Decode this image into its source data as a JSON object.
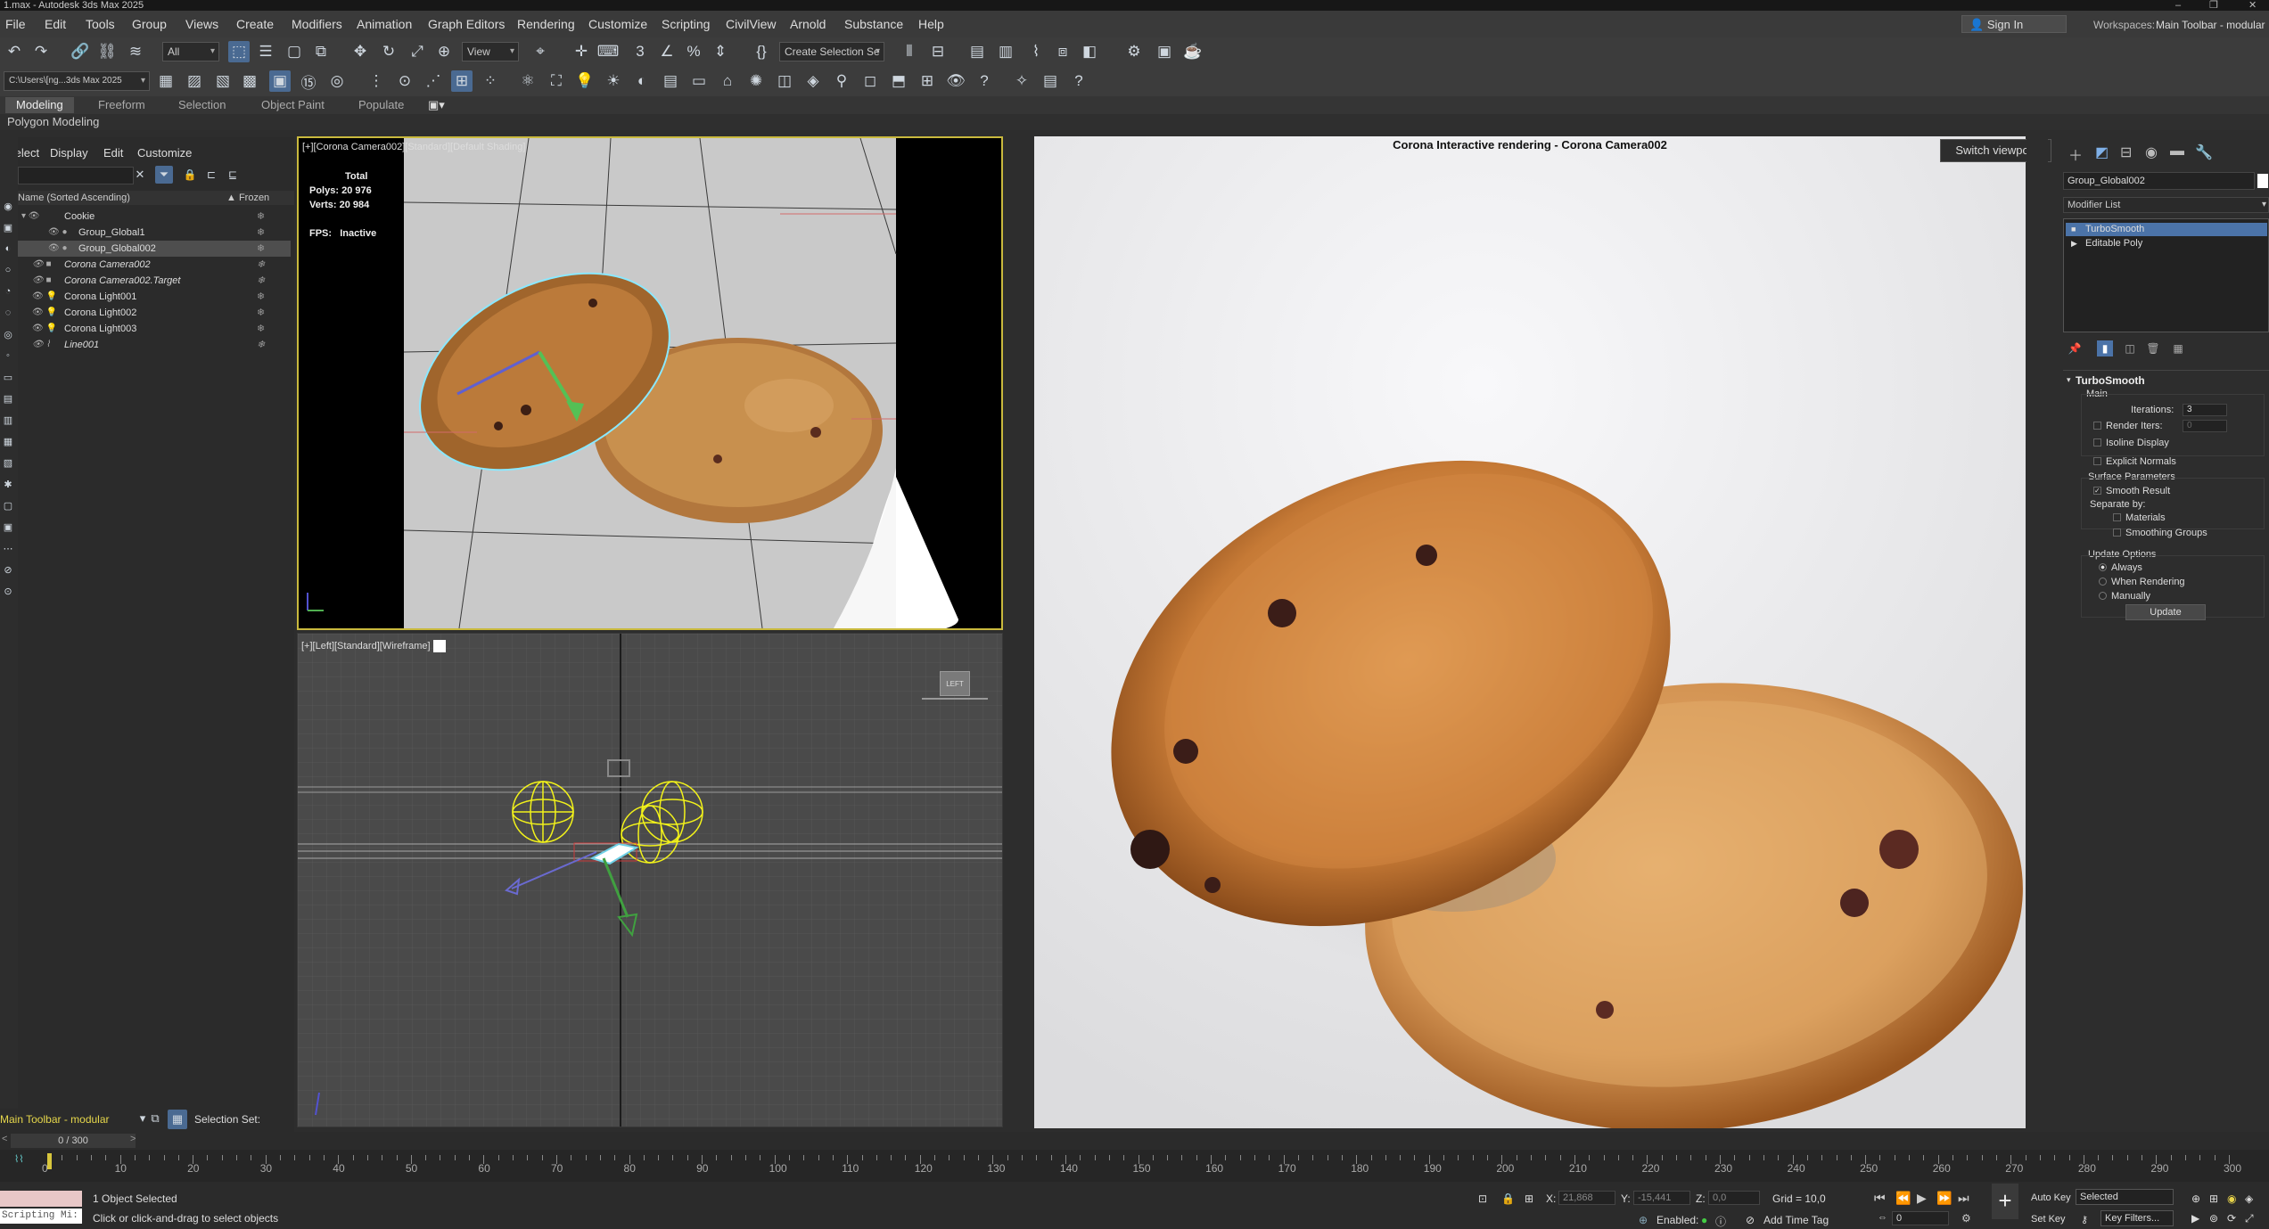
{
  "app": {
    "title": "1.max - Autodesk 3ds Max 2025",
    "window_controls": [
      "–",
      "❐",
      "✕"
    ]
  },
  "menu": [
    "File",
    "Edit",
    "Tools",
    "Group",
    "Views",
    "Create",
    "Modifiers",
    "Animation",
    "Graph Editors",
    "Rendering",
    "Customize",
    "Scripting",
    "CivilView",
    "Arnold",
    "Substance",
    "Help"
  ],
  "account": {
    "sign_in": "Sign In",
    "workspaces_label": "Workspaces:",
    "workspace": "Main Toolbar - modular"
  },
  "toolbar": {
    "selection_filter": "All",
    "ref_coord": "View",
    "named_selection": "Create Selection Se",
    "path": "C:\\Users\\[ng...3ds Max 2025"
  },
  "ribbon": {
    "tabs": [
      "Modeling",
      "Freeform",
      "Selection",
      "Object Paint",
      "Populate"
    ],
    "active": "Modeling",
    "sub": "Polygon Modeling"
  },
  "scene_explorer": {
    "menu": [
      "Select",
      "Display",
      "Edit",
      "Customize"
    ],
    "col_name": "Name (Sorted Ascending)",
    "col_frozen": "▲ Frozen",
    "rows": [
      {
        "name": "Cookie",
        "italic": false,
        "selected": false
      },
      {
        "name": "Group_Global1",
        "italic": false,
        "selected": false
      },
      {
        "name": "Group_Global002",
        "italic": false,
        "selected": true
      },
      {
        "name": "Corona Camera002",
        "italic": true,
        "selected": false
      },
      {
        "name": "Corona Camera002.Target",
        "italic": true,
        "selected": false
      },
      {
        "name": "Corona Light001",
        "italic": false,
        "selected": false
      },
      {
        "name": "Corona Light002",
        "italic": false,
        "selected": false
      },
      {
        "name": "Corona Light003",
        "italic": false,
        "selected": false
      },
      {
        "name": "Line001",
        "italic": true,
        "selected": false
      }
    ]
  },
  "viewport_top": {
    "label": "[+][Corona Camera002][Standard][Default Shading]",
    "stats": {
      "total": "Total",
      "polys_label": "Polys:",
      "polys": "20 976",
      "verts_label": "Verts:",
      "verts": "20 984",
      "fps_label": "FPS:",
      "fps": "Inactive"
    }
  },
  "viewport_left": {
    "label": "[+][Left][Standard][Wireframe]",
    "viewcube": "LEFT"
  },
  "render": {
    "title": "Corona Interactive rendering - Corona Camera002",
    "switch": "Switch viewport"
  },
  "command_panel": {
    "object_name": "Group_Global002",
    "modifier_list": "Modifier List",
    "stack": [
      "TurboSmooth",
      "Editable Poly"
    ],
    "turbosmooth": {
      "title": "TurboSmooth",
      "main": "Main",
      "iterations_label": "Iterations:",
      "iterations": "3",
      "render_iters_label": "Render Iters:",
      "render_iters": "0",
      "isoline": "Isoline Display",
      "explicit": "Explicit Normals",
      "surface": "Surface Parameters",
      "smooth_result": "Smooth Result",
      "separate_by": "Separate by:",
      "materials": "Materials",
      "smoothing_groups": "Smoothing Groups",
      "update_options": "Update Options",
      "always": "Always",
      "when_rendering": "When Rendering",
      "manually": "Manually",
      "update": "Update"
    }
  },
  "bottom": {
    "workspace_toolbar": "Main Toolbar - modular",
    "selection_set": "Selection Set:",
    "time": "0 / 300",
    "ticks": [
      "0",
      "10",
      "20",
      "30",
      "40",
      "50",
      "60",
      "70",
      "80",
      "90",
      "100",
      "110",
      "120",
      "130",
      "140",
      "150",
      "160",
      "170",
      "180",
      "190",
      "200",
      "210",
      "220",
      "230",
      "240",
      "250",
      "260",
      "270",
      "280",
      "290",
      "300"
    ],
    "status1": "1 Object Selected",
    "status2": "Click or click-and-drag to select objects",
    "script": "Scripting Mi:",
    "x_label": "X:",
    "x": "21,868",
    "y_label": "Y:",
    "y": "-15,441",
    "z_label": "Z:",
    "z": "0,0",
    "grid": "Grid = 10,0",
    "enabled": "Enabled:",
    "add_time_tag": "Add Time Tag",
    "auto_key": "Auto Key",
    "set_key": "Set Key",
    "selected": "Selected",
    "key_filters": "Key Filters...",
    "frame": "0"
  },
  "colors": {
    "accent": "#4b73a8",
    "viewport_border": "#c9b93d",
    "light_gizmo": "#f2f21a"
  }
}
